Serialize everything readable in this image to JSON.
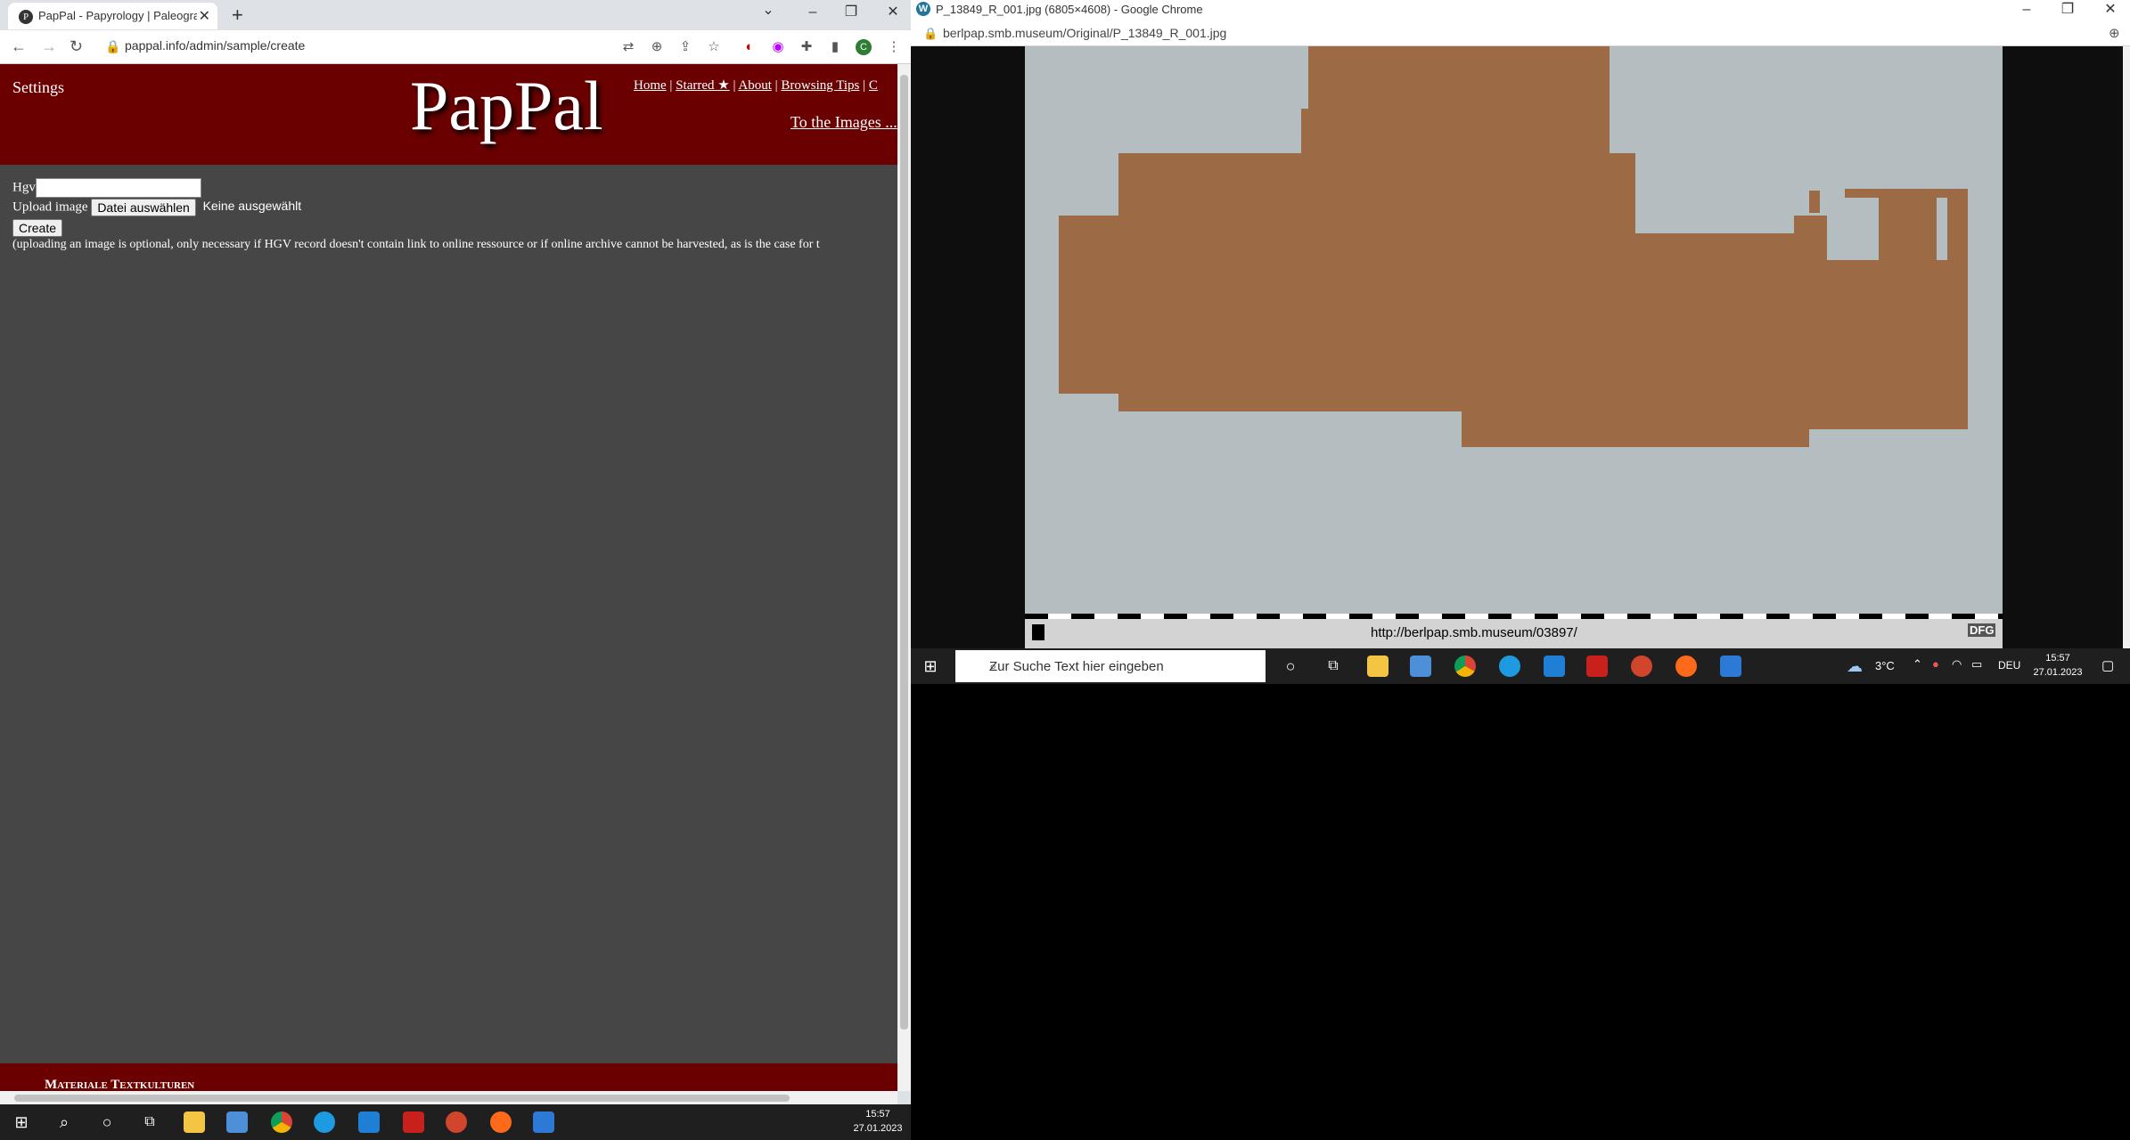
{
  "left_browser": {
    "tab_title": "PapPal - Papyrology | Paleography",
    "favicon": "P",
    "url": "pappal.info/admin/sample/create",
    "window_controls": [
      "–",
      "❐",
      "✕"
    ],
    "tab_close": "✕",
    "new_tab": "+"
  },
  "page": {
    "settings": "Settings",
    "logo": "PapPal",
    "nav": {
      "home": "Home",
      "starred": "Starred ★",
      "about": "About",
      "browsing_tips": "Browsing Tips",
      "sep": "|",
      "trailing": "C"
    },
    "to_images": "To the Images ...",
    "form": {
      "hgv_label": "Hgv",
      "upload_label": "Upload image",
      "file_button": "Datei auswählen",
      "file_status": "Keine ausgewählt",
      "create_button": "Create"
    },
    "note": "(uploading an image is optional, only necessary if HGV record doesn't contain link to online ressource or if online archive cannot be harvested, as is the case for t",
    "footer": "Materiale Textkulturen"
  },
  "left_taskbar": {
    "time": "15:57",
    "date": "27.01.2023"
  },
  "right_browser": {
    "title": "P_13849_R_001.jpg (6805×4608) - Google Chrome",
    "favicon": "W",
    "url": "berlpap.smb.museum/Original/P_13849_R_001.jpg",
    "window_controls": [
      "–",
      "❐",
      "✕"
    ],
    "image_link": "http://berlpap.smb.museum/03897/"
  },
  "right_taskbar": {
    "search_placeholder": "Zur Suche Text hier eingeben",
    "temperature": "3°C",
    "language": "DEU",
    "time": "15:57",
    "date": "27.01.2023"
  },
  "colors": {
    "header_red": "#6b0000",
    "page_bg": "#464646",
    "papyrus": "#9c6a44"
  }
}
